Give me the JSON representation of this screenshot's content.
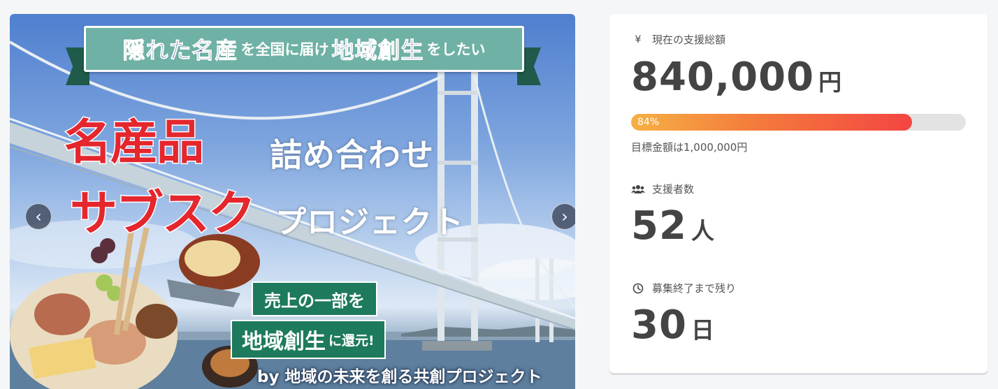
{
  "hero": {
    "top_banner": {
      "part1": "隠れた名産",
      "part2": "を全国に届け",
      "part3": "地域創生",
      "part4": "をしたい"
    },
    "title_red_1": "名産品",
    "title_white_1": "詰め合わせ",
    "title_red_2": "サブスク",
    "title_white_2": "プロジェクト",
    "tag_line_1": "売上の一部を",
    "tag_line_2_big": "地域創生",
    "tag_line_2_small": "に還元!",
    "byline": "by 地域の未来を創る共創プロジェクト",
    "prev_icon": "chevron-left-icon",
    "next_icon": "chevron-right-icon",
    "prev_glyph": "‹",
    "next_glyph": "›"
  },
  "stats": {
    "total": {
      "icon": "yen-icon",
      "icon_glyph": "¥",
      "label": "現在の支援総額",
      "value": "840,000",
      "unit": "円"
    },
    "progress": {
      "percent": 84,
      "percent_label": "84%",
      "goal_text": "目標金額は1,000,000円"
    },
    "supporters": {
      "icon": "users-icon",
      "label": "支援者数",
      "value": "52",
      "unit": "人"
    },
    "remaining": {
      "icon": "clock-icon",
      "label": "募集終了まで残り",
      "value": "30",
      "unit": "日"
    }
  },
  "colors": {
    "accent_red": "#e5262d",
    "banner_green": "#1d7a5c",
    "progress_start": "#f6b044",
    "progress_end": "#f34543",
    "text_dark": "#444444"
  }
}
